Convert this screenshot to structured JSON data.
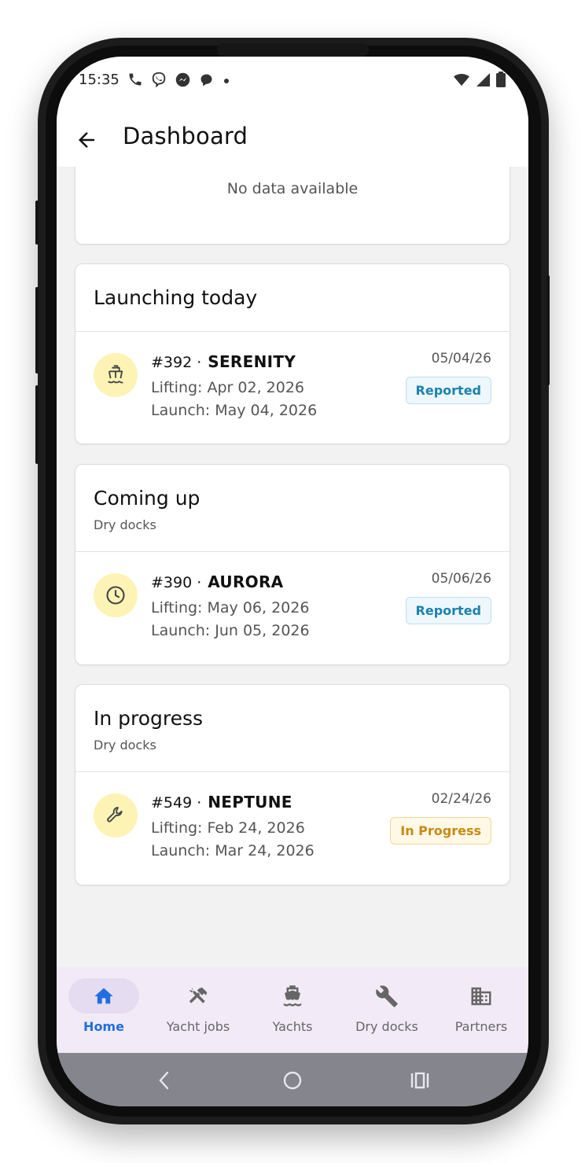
{
  "status_bar": {
    "time": "15:35",
    "icons": [
      "phone-icon",
      "viber-icon",
      "messenger-icon",
      "chat-icon",
      "dot-icon"
    ],
    "right_icons": [
      "wifi-icon",
      "signal-icon",
      "battery-icon"
    ]
  },
  "app_bar": {
    "title": "Dashboard"
  },
  "empty_card": {
    "text": "No data available"
  },
  "sections": [
    {
      "title": "Launching today",
      "subtitle": "",
      "job": {
        "number": "#392 ·",
        "name": "SERENITY",
        "lifting": "Lifting: Apr 02, 2026",
        "launch": "Launch: May 04, 2026",
        "date": "05/04/26",
        "status": "Reported",
        "icon": "ship-icon"
      }
    },
    {
      "title": "Coming up",
      "subtitle": "Dry docks",
      "job": {
        "number": "#390 ·",
        "name": "AURORA",
        "lifting": "Lifting: May 06, 2026",
        "launch": "Launch: Jun 05, 2026",
        "date": "05/06/26",
        "status": "Reported",
        "icon": "clock-icon"
      }
    },
    {
      "title": "In progress",
      "subtitle": "Dry docks",
      "job": {
        "number": "#549 ·",
        "name": "NEPTUNE",
        "lifting": "Lifting: Feb 24, 2026",
        "launch": "Launch: Mar 24, 2026",
        "date": "02/24/26",
        "status": "In Progress",
        "icon": "wrench-icon"
      }
    }
  ],
  "bottom_nav": {
    "items": [
      {
        "label": "Home",
        "icon": "home-icon",
        "active": true
      },
      {
        "label": "Yacht jobs",
        "icon": "tools-icon",
        "active": false
      },
      {
        "label": "Yachts",
        "icon": "ship-icon",
        "active": false
      },
      {
        "label": "Dry docks",
        "icon": "wrench-icon",
        "active": false
      },
      {
        "label": "Partners",
        "icon": "building-icon",
        "active": false
      }
    ]
  },
  "colors": {
    "accent": "#1f6fe0",
    "reported": "#1b82b0",
    "in_progress": "#c88a12",
    "icon_bg": "#fcf3b5",
    "nav_bg": "#f2ebf7"
  }
}
